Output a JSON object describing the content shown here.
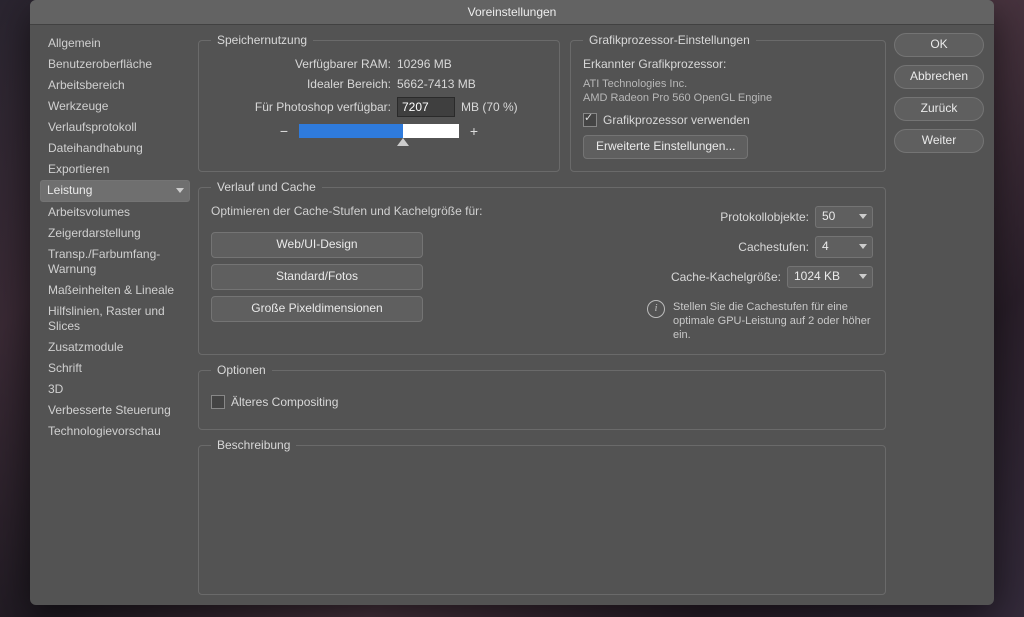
{
  "window": {
    "title": "Voreinstellungen"
  },
  "sidebar": {
    "items": [
      "Allgemein",
      "Benutzeroberfläche",
      "Arbeitsbereich",
      "Werkzeuge",
      "Verlaufsprotokoll",
      "Dateihandhabung",
      "Exportieren",
      "Leistung",
      "Arbeitsvolumes",
      "Zeigerdarstellung",
      "Transp./Farbumfang-Warnung",
      "Maßeinheiten & Lineale",
      "Hilfslinien, Raster und Slices",
      "Zusatzmodule",
      "Schrift",
      "3D",
      "Verbesserte Steuerung",
      "Technologievorschau"
    ],
    "selected_index": 7
  },
  "buttons": {
    "ok": "OK",
    "cancel": "Abbrechen",
    "back": "Zurück",
    "next": "Weiter"
  },
  "memory": {
    "legend": "Speichernutzung",
    "available_label": "Verfügbarer RAM:",
    "available_value": "10296 MB",
    "ideal_label": "Idealer Bereich:",
    "ideal_value": "5662-7413 MB",
    "photoshop_label": "Für Photoshop verfügbar:",
    "photoshop_input": "7207",
    "photoshop_unit": "MB (70 %)",
    "minus": "−",
    "plus": "+",
    "slider_percent": 65
  },
  "gpu": {
    "legend": "Grafikprozessor-Einstellungen",
    "detected_label": "Erkannter Grafikprozessor:",
    "vendor": "ATI Technologies Inc.",
    "device": "AMD Radeon Pro 560 OpenGL Engine",
    "use_gpu_label": "Grafikprozessor verwenden",
    "use_gpu_checked": true,
    "advanced_button": "Erweiterte Einstellungen..."
  },
  "cache": {
    "legend": "Verlauf und Cache",
    "optimize_label": "Optimieren der Cache-Stufen und Kachelgröße für:",
    "presets": [
      "Web/UI-Design",
      "Standard/Fotos",
      "Große Pixeldimensionen"
    ],
    "history_label": "Protokollobjekte:",
    "history_value": "50",
    "levels_label": "Cachestufen:",
    "levels_value": "4",
    "tile_label": "Cache-Kachelgröße:",
    "tile_value": "1024 KB",
    "info_text": "Stellen Sie die Cachestufen für eine optimale GPU-Leistung auf 2 oder höher ein."
  },
  "options": {
    "legend": "Optionen",
    "legacy_label": "Älteres Compositing",
    "legacy_checked": false
  },
  "description": {
    "legend": "Beschreibung"
  }
}
